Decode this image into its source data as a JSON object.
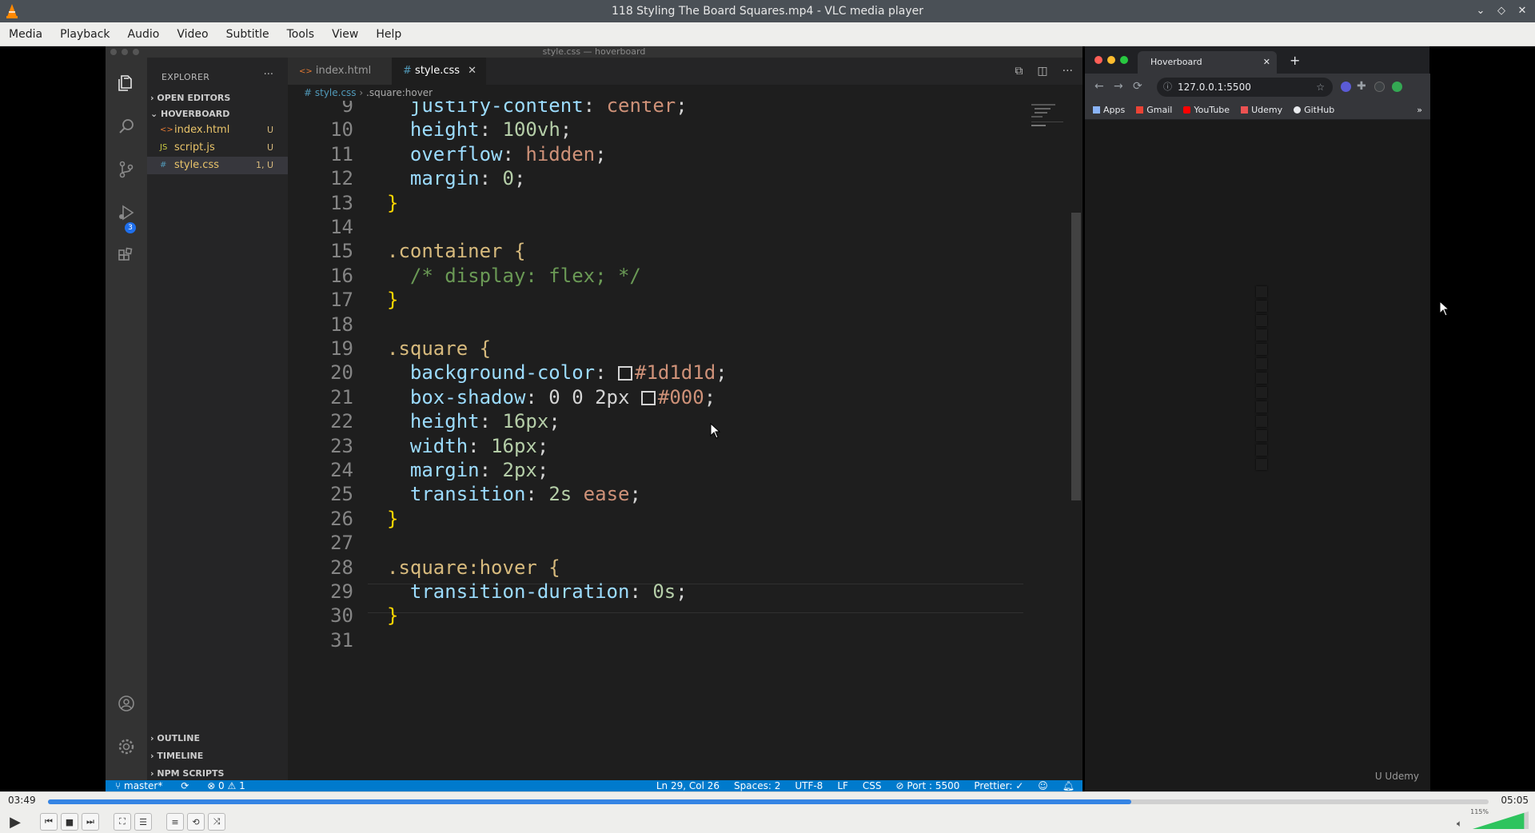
{
  "window": {
    "title": "118 Styling The Board Squares.mp4 - VLC media player"
  },
  "menu": [
    "Media",
    "Playback",
    "Audio",
    "Video",
    "Subtitle",
    "Tools",
    "View",
    "Help"
  ],
  "player": {
    "time_current": "03:49",
    "time_total": "05:05",
    "progress": 0.752,
    "volume_label": "115%",
    "volume": 1.15
  },
  "vscode": {
    "title": "style.css — hoverboard",
    "explorer_label": "EXPLORER",
    "sections": {
      "open_editors": "OPEN EDITORS",
      "project": "HOVERBOARD",
      "outline": "OUTLINE",
      "timeline": "TIMELINE",
      "npm_scripts": "NPM SCRIPTS"
    },
    "files": [
      {
        "icon": "<>",
        "name": "index.html",
        "status": "U"
      },
      {
        "icon": "JS",
        "name": "script.js",
        "status": "U"
      },
      {
        "icon": "#",
        "name": "style.css",
        "status": "1, U"
      }
    ],
    "scm_badge": "3",
    "tabs": [
      {
        "icon": "<>",
        "label": "index.html"
      },
      {
        "icon": "#",
        "label": "style.css"
      }
    ],
    "breadcrumb": {
      "file": "# style.css",
      "selector": ".square:hover"
    },
    "line_numbers": [
      "9",
      "10",
      "11",
      "12",
      "13",
      "14",
      "15",
      "16",
      "17",
      "18",
      "19",
      "20",
      "21",
      "22",
      "23",
      "24",
      "25",
      "26",
      "27",
      "28",
      "29",
      "30",
      "31"
    ],
    "status": {
      "branch": "master*",
      "problems": "⊗ 0 ⚠ 1",
      "position": "Ln 29, Col 26",
      "spaces": "Spaces: 2",
      "encoding": "UTF-8",
      "eol": "LF",
      "language": "CSS",
      "port": "⊘ Port : 5500",
      "prettier": "Prettier: ✓"
    }
  },
  "code_lines": [
    [
      "  ",
      "justify-content",
      ": ",
      "center",
      ";"
    ],
    [
      "  ",
      "height",
      ": ",
      "100vh",
      ";"
    ],
    [
      "  ",
      "overflow",
      ": ",
      "hidden",
      ";"
    ],
    [
      "  ",
      "margin",
      ": ",
      "0",
      ";"
    ],
    "}",
    "",
    ".container {",
    "  /* display: flex; */",
    "}",
    "",
    ".square {",
    [
      "  ",
      "background-color",
      ": ",
      "#1d1d1d",
      ";"
    ],
    [
      "  ",
      "box-shadow",
      ": 0 0 2px ",
      "#000",
      ";"
    ],
    [
      "  ",
      "height",
      ": ",
      "16px",
      ";"
    ],
    [
      "  ",
      "width",
      ": ",
      "16px",
      ";"
    ],
    [
      "  ",
      "margin",
      ": ",
      "2px",
      ";"
    ],
    [
      "  ",
      "transition",
      ": ",
      "2s ",
      "ease",
      ";"
    ],
    "}",
    "",
    ".square:hover {",
    [
      "  ",
      "transition-duration",
      ": ",
      "0s",
      ";"
    ],
    "}",
    ""
  ],
  "browser": {
    "tab_title": "Hoverboard",
    "url": "127.0.0.1:5500",
    "bookmarks": [
      "Apps",
      "Gmail",
      "YouTube",
      "Udemy",
      "GitHub"
    ],
    "watermark": "Udemy"
  },
  "colors": {
    "vsc_status": "#007acc",
    "vlc_progress": "#3584e4",
    "square": "#1d1d1d"
  }
}
